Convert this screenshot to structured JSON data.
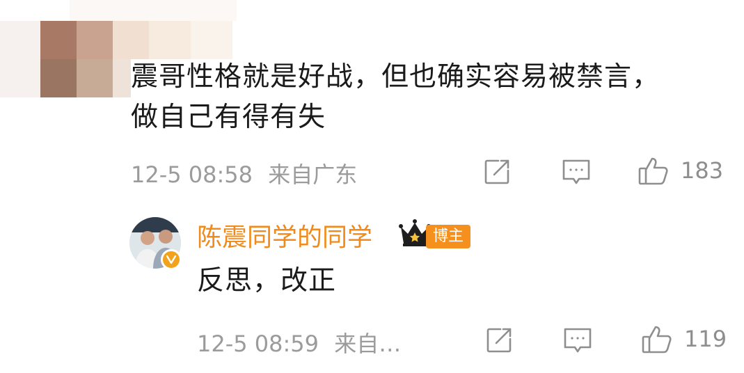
{
  "colors": {
    "username": "#f08a1a",
    "badge_bg": "#f5901e",
    "meta": "#9b9b9b",
    "text": "#1a1a1a"
  },
  "comments": [
    {
      "text_line1": "震哥性格就是好战，但也确实容易被禁言，",
      "text_line2": "做自己有得有失",
      "date": "12-5 08:58",
      "location": "来自广东",
      "likes": "183",
      "icons": [
        "share-icon",
        "comment-icon",
        "like-icon"
      ]
    },
    {
      "username": "陈震同学的同学",
      "role_badge": "博主",
      "text": "反思，改正",
      "date": "12-5 08:59",
      "location": "来自…",
      "likes": "119",
      "icons": [
        "crown-icon",
        "verified-v-icon",
        "share-icon",
        "comment-icon",
        "like-icon"
      ]
    }
  ]
}
